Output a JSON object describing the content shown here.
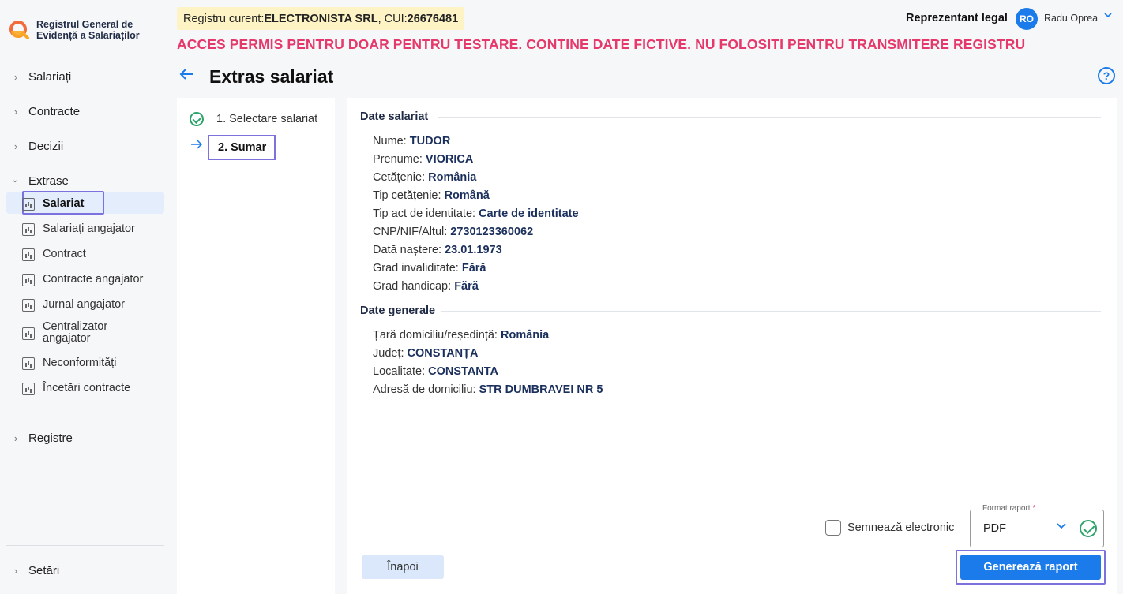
{
  "app": {
    "name_line1": "Registrul General de",
    "name_line2": "Evidență a Salariaților"
  },
  "header": {
    "registru_prefix": "Registru curent: ",
    "company": "ELECTRONISTA SRL",
    "cui_prefix": ", CUI: ",
    "cui": "26676481",
    "warning": "ACCES PERMIS PENTRU DOAR PENTRU TESTARE. CONTINE DATE FICTIVE. NU FOLOSITI PENTRU TRANSMITERE REGISTRU",
    "role": "Reprezentant legal",
    "avatar_initials": "RO",
    "user_name": "Radu Oprea"
  },
  "sidebar": {
    "groups": [
      {
        "label": "Salariați"
      },
      {
        "label": "Contracte"
      },
      {
        "label": "Decizii"
      },
      {
        "label": "Extrase"
      },
      {
        "label": "Registre"
      },
      {
        "label": "Setări"
      }
    ],
    "extrase_items": [
      {
        "label": "Salariat"
      },
      {
        "label": "Salariați angajator"
      },
      {
        "label": "Contract"
      },
      {
        "label": "Contracte angajator"
      },
      {
        "label": "Jurnal angajator"
      },
      {
        "label": "Centralizator angajator"
      },
      {
        "label": "Neconformități"
      },
      {
        "label": "Încetări contracte"
      }
    ]
  },
  "page": {
    "title": "Extras salariat",
    "help": "?"
  },
  "steps": {
    "step1": "1. Selectare salariat",
    "step2": "2. Sumar"
  },
  "date_salariat": {
    "title": "Date salariat",
    "fields": [
      {
        "label": "Nume: ",
        "value": "TUDOR"
      },
      {
        "label": "Prenume: ",
        "value": "VIORICA"
      },
      {
        "label": "Cetățenie: ",
        "value": "România"
      },
      {
        "label": "Tip cetățenie: ",
        "value": "Română"
      },
      {
        "label": "Tip act de identitate: ",
        "value": "Carte de identitate"
      },
      {
        "label": "CNP/NIF/Altul: ",
        "value": "2730123360062"
      },
      {
        "label": "Dată naștere: ",
        "value": "23.01.1973"
      },
      {
        "label": "Grad invaliditate: ",
        "value": "Fără"
      },
      {
        "label": "Grad handicap: ",
        "value": "Fără"
      }
    ]
  },
  "date_generale": {
    "title": "Date generale",
    "fields": [
      {
        "label": "Țară domiciliu/reședință: ",
        "value": "România"
      },
      {
        "label": "Județ: ",
        "value": "CONSTANȚA"
      },
      {
        "label": "Localitate: ",
        "value": "CONSTANTA"
      },
      {
        "label": "Adresă de domiciliu: ",
        "value": "STR DUMBRAVEI NR 5"
      }
    ]
  },
  "footer": {
    "sign_label": "Semnează electronic",
    "format_label": "Format raport",
    "format_required": "*",
    "format_value": "PDF",
    "back_button": "Înapoi",
    "generate_button": "Generează raport"
  },
  "colors": {
    "accent": "#1b7bea",
    "warning": "#e5396c",
    "success": "#2ea36b",
    "highlight": "#7b72e0"
  }
}
